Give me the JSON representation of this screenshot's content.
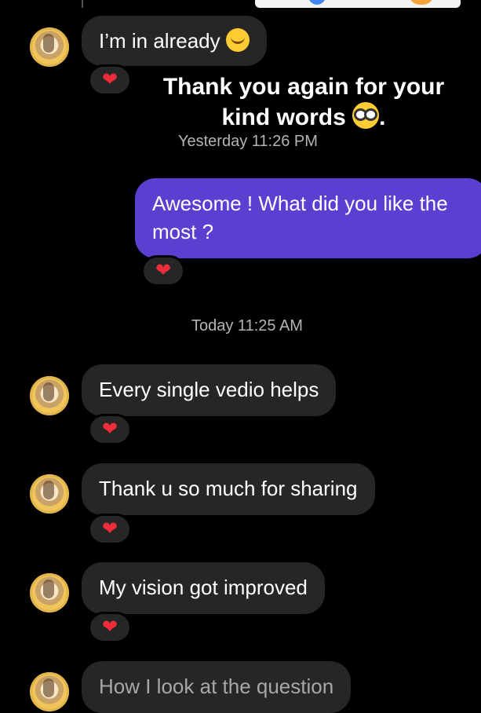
{
  "messages": [
    {
      "text": "I’m in already"
    },
    {
      "text": "Awesome ! What did you like the most ?"
    },
    {
      "text": "Every single vedio helps"
    },
    {
      "text": "Thank u so much for sharing"
    },
    {
      "text": "My vision got improved"
    },
    {
      "text": "How I look at the question"
    }
  ],
  "overlay": {
    "line1": "Thank you again for your",
    "line2": "kind words",
    "line2_end": "."
  },
  "timestamps": {
    "yesterday": "Yesterday 11:26 PM",
    "today": "Today 11:25 AM"
  },
  "reaction": {
    "icon": "heart-icon",
    "glyph": "❤"
  },
  "colors": {
    "incoming_bubble": "#262626",
    "outgoing_bubble": "#5b3fd0",
    "heart": "#ed2d3a",
    "background": "#000000"
  }
}
